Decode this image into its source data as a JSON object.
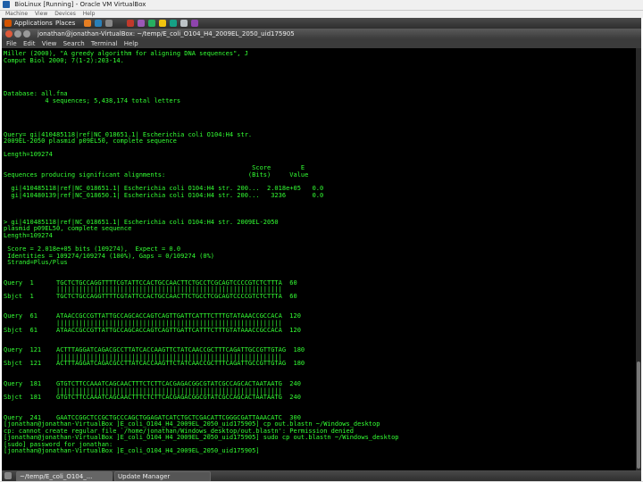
{
  "vbox": {
    "title": "BioLinux [Running] - Oracle VM VirtualBox",
    "menu": [
      "Machine",
      "View",
      "Devices",
      "Help"
    ]
  },
  "panel": {
    "applications": "Applications",
    "places": "Places"
  },
  "terminal": {
    "title": "jonathan@jonathan-VirtualBox: ~/temp/E_coli_O104_H4_2009EL_2050_uid175905",
    "menu": [
      "File",
      "Edit",
      "View",
      "Search",
      "Terminal",
      "Help"
    ],
    "lines": [
      "Miller (2000), \"A greedy algorithm for aligning DNA sequences\", J",
      "Comput Biol 2000; 7(1-2):203-14.",
      "",
      "",
      "",
      "",
      "Database: all.fna",
      "           4 sequences; 5,438,174 total letters",
      "",
      "",
      "",
      "",
      "Query= gi|410485118|ref|NC_018651.1| Escherichia coli O104:H4 str.",
      "2009EL-2050 plasmid p09EL50, complete sequence",
      "",
      "Length=109274",
      "",
      "                                                                  Score        E",
      "Sequences producing significant alignments:                      (Bits)     Value",
      "",
      "  gi|410485118|ref|NC_018651.1| Escherichia coli O104:H4 str. 200...  2.018e+05   0.0",
      "  gi|410480139|ref|NC_018650.1| Escherichia coli O104:H4 str. 200...   3236       0.0",
      "",
      "",
      "",
      "> gi|410485118|ref|NC_018651.1| Escherichia coli O104:H4 str. 2009EL-2050",
      "plasmid p09EL50, complete sequence",
      "Length=109274",
      "",
      " Score = 2.018e+05 bits (109274),  Expect = 0.0",
      " Identities = 109274/109274 (100%), Gaps = 0/109274 (0%)",
      " Strand=Plus/Plus",
      "",
      "",
      "Query  1      TGCTCTGCCAGGTTTTCGTATTCCACTGCCAACTTCTGCCTCGCAGTCCCCGTCTCTTTA  60",
      "              ||||||||||||||||||||||||||||||||||||||||||||||||||||||||||||",
      "Sbjct  1      TGCTCTGCCAGGTTTTCGTATTCCACTGCCAACTTCTGCCTCGCAGTCCCCGTCTCTTTA  60",
      "",
      "",
      "Query  61     ATAACCGCCGTTATTGCCAGCACCAGTCAGTTGATTCATTTCTTTGTATAAACCGCCACA  120",
      "              ||||||||||||||||||||||||||||||||||||||||||||||||||||||||||||",
      "Sbjct  61     ATAACCGCCGTTATTGCCAGCACCAGTCAGTTGATTCATTTCTTTGTATAAACCGCCACA  120",
      "",
      "",
      "Query  121    ACTTTAGGATCAGACGCCTTATCACCAAGTTCTATCAACCGCTTTCAGATTGCCGTTGTAG  180",
      "              ||||||||||||||||||||||||||||||||||||||||||||||||||||||||||||",
      "Sbjct  121    ACTTTAGGATCAGACGCCTTATCACCAAGTTCTATCAACCGCTTTCAGATTGCCGTTGTAG  180",
      "",
      "",
      "Query  181    GTGTCTTCCAAATCAGCAACTTTCTCTTCACGAGACGGCGTATCGCCAGCACTAATAATG  240",
      "              ||||||||||||||||||||||||||||||||||||||||||||||||||||||||||||",
      "Sbjct  181    GTGTCTTCCAAATCAGCAACTTTCTCTTCACGAGACGGCGTATCGCCAGCACTAATAATG  240",
      "",
      "",
      "Query  241    GAATCCGGCTCCGCTGCCCAGCTGGAGATCATCTGCTCGACATTCGGGCGATTAAACATC  300",
      "[jonathan@jonathan-VirtualBox ]E_coli_O104_H4_2009EL_2050_uid175905] cp out.blastn ~/Windows_desktop",
      "cp: cannot create regular file `/home/jonathan/Windows_desktop/out.blastn': Permission denied",
      "[jonathan@jonathan-VirtualBox ]E_coli_O104_H4_2009EL_2050_uid175905] sudo cp out.blastn ~/Windows_desktop",
      "[sudo] password for jonathan:",
      "[jonathan@jonathan-VirtualBox ]E_coli_O104_H4_2009EL_2050_uid175905] "
    ]
  },
  "taskbar": {
    "tasks": [
      "~/temp/E_coli_O104_...",
      "Update Manager"
    ]
  },
  "colors": {
    "terminal_fg": "#33ff33",
    "terminal_bg": "#000000",
    "panel_bg": "#3a3a3a"
  }
}
